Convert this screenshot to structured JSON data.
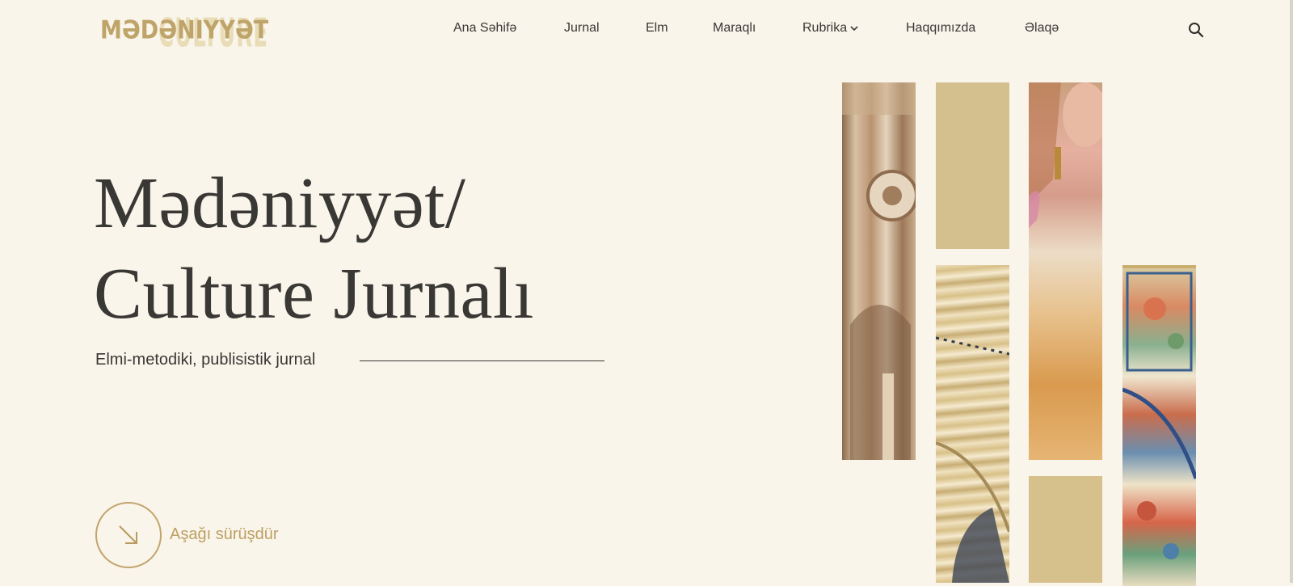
{
  "logo": {
    "front": "MƏDƏNIYYƏT",
    "back": "CULTURE"
  },
  "nav": {
    "items": [
      "Ana Səhifə",
      "Jurnal",
      "Elm",
      "Maraqlı",
      "Rubrika",
      "Haqqımızda",
      "Əlaqə"
    ],
    "dropdown_item": "Rubrika",
    "search_icon": "search-icon"
  },
  "hero": {
    "title_line1": "Mədəniyyət/",
    "title_line2": "Culture Jurnalı",
    "subtitle": "Elmi-metodiki, publisistik jurnal"
  },
  "scroll": {
    "label": "Aşağı sürüşdür",
    "icon": "arrow-down-right-icon"
  },
  "colors": {
    "background": "#f9f5ea",
    "accent": "#c3a46c",
    "text": "#3a3835",
    "tile": "#d3c08e"
  }
}
